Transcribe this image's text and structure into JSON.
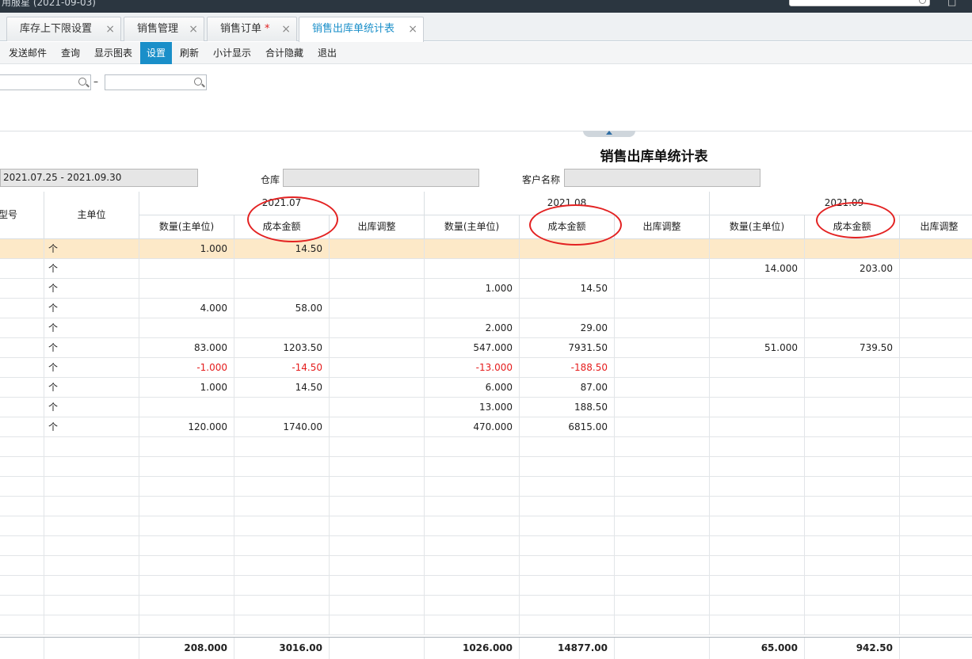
{
  "window": {
    "title": "用服星  (2021-09-03)"
  },
  "tabs": [
    {
      "label": "库存上下限设置",
      "dirty": false,
      "active": false
    },
    {
      "label": "销售管理",
      "dirty": false,
      "active": false
    },
    {
      "label": "销售订单",
      "dirty": true,
      "active": false
    },
    {
      "label": "销售出库单统计表",
      "dirty": false,
      "active": true
    }
  ],
  "dirty_mark": "*",
  "close_glyph": "×",
  "toolbar": [
    "发送邮件",
    "查询",
    "显示图表",
    "设置",
    "刷新",
    "小计显示",
    "合计隐藏",
    "退出"
  ],
  "toolbar_active": "设置",
  "query": {
    "range_separator": "–"
  },
  "report": {
    "title": "销售出库单统计表",
    "period_value": "2021.07.25 - 2021.09.30",
    "warehouse_label": "仓库",
    "warehouse_value": "",
    "customer_label": "客户名称",
    "customer_value": ""
  },
  "columns": {
    "model": "型号",
    "unit": "主单位",
    "months": [
      "2021.07",
      "2021.08",
      "2021.09"
    ],
    "sub": [
      "数量(主单位)",
      "成本金额",
      "出库调整"
    ]
  },
  "rows": [
    {
      "unit": "个",
      "vals": [
        "1.000",
        "14.50",
        "",
        "",
        "",
        "",
        "",
        "",
        ""
      ]
    },
    {
      "unit": "个",
      "vals": [
        "",
        "",
        "",
        "",
        "",
        "",
        "14.000",
        "203.00",
        ""
      ]
    },
    {
      "unit": "个",
      "vals": [
        "",
        "",
        "",
        "1.000",
        "14.50",
        "",
        "",
        "",
        ""
      ]
    },
    {
      "unit": "个",
      "vals": [
        "4.000",
        "58.00",
        "",
        "",
        "",
        "",
        "",
        "",
        ""
      ]
    },
    {
      "unit": "个",
      "vals": [
        "",
        "",
        "",
        "2.000",
        "29.00",
        "",
        "",
        "",
        ""
      ]
    },
    {
      "unit": "个",
      "vals": [
        "83.000",
        "1203.50",
        "",
        "547.000",
        "7931.50",
        "",
        "51.000",
        "739.50",
        ""
      ]
    },
    {
      "unit": "个",
      "vals": [
        "-1.000",
        "-14.50",
        "",
        "-13.000",
        "-188.50",
        "",
        "",
        "",
        ""
      ]
    },
    {
      "unit": "个",
      "vals": [
        "1.000",
        "14.50",
        "",
        "6.000",
        "87.00",
        "",
        "",
        "",
        ""
      ]
    },
    {
      "unit": "个",
      "vals": [
        "",
        "",
        "",
        "13.000",
        "188.50",
        "",
        "",
        "",
        ""
      ]
    },
    {
      "unit": "个",
      "vals": [
        "120.000",
        "1740.00",
        "",
        "470.000",
        "6815.00",
        "",
        "",
        "",
        ""
      ]
    }
  ],
  "totals": [
    "208.000",
    "3016.00",
    "",
    "1026.000",
    "14877.00",
    "",
    "65.000",
    "942.50",
    ""
  ],
  "colors": {
    "accent": "#1a8fc9",
    "highlight_row": "#fde9c8",
    "negative": "#e51c1c",
    "annotation": "#e32222"
  }
}
